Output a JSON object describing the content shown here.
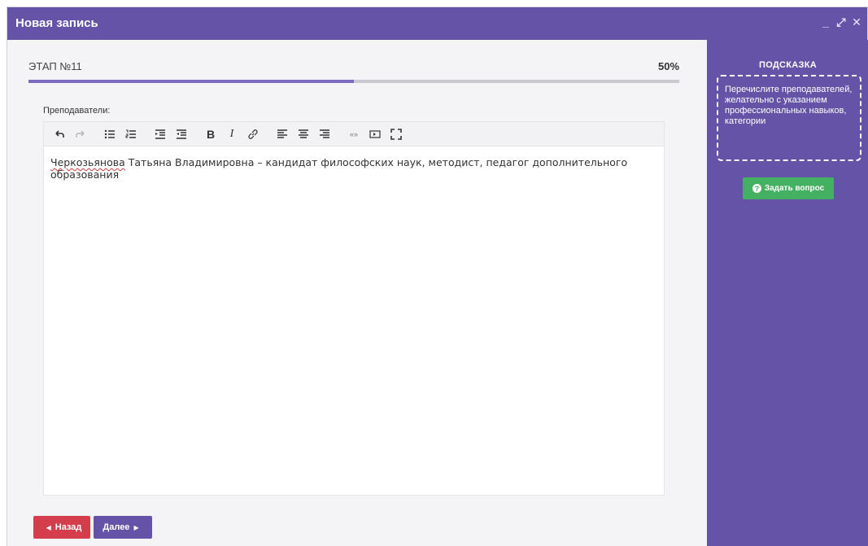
{
  "window": {
    "title": "Новая запись",
    "controls": {
      "minimize": "_",
      "expand": "⤢",
      "close": "✕"
    }
  },
  "stage": {
    "label": "ЭТАП №11",
    "percent_text": "50%",
    "progress": 0.5
  },
  "field": {
    "label": "Преподаватели:"
  },
  "toolbar": {
    "icons": [
      "undo-icon",
      "redo-icon",
      "bullet-list-icon",
      "numbered-list-icon",
      "indent-icon",
      "outdent-icon",
      "bold-icon",
      "italic-icon",
      "link-icon",
      "align-left-icon",
      "align-center-icon",
      "align-right-icon",
      "blockquote-icon",
      "media-icon",
      "fullscreen-icon"
    ]
  },
  "editor": {
    "text_first_word": "Черкозьянова",
    "text_rest": " Татьяна Владимировна – кандидат философских наук, методист, педагог дополнительного образования"
  },
  "nav": {
    "back_label": "Назад",
    "next_label": "Далее"
  },
  "hint": {
    "title": "ПОДСКАЗКА",
    "text": "Перечислите преподавателей, желательно с указанием профессиональных навыков, категории",
    "ask_label": "Задать вопрос"
  },
  "colors": {
    "brand": "#6453a6",
    "progress_fill": "#7b6cc0",
    "back_button": "#d43e4c",
    "ask_button": "#44b061"
  }
}
